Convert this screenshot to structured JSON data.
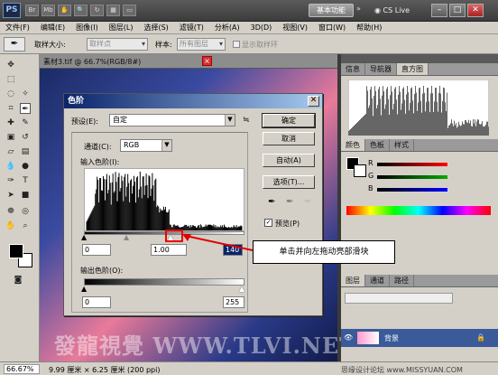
{
  "titlebar": {
    "logo": "PS",
    "workspace": "基本功能",
    "cslive": "CS Live",
    "min": "–",
    "max": "□",
    "close": "✕"
  },
  "menu": [
    "文件(F)",
    "编辑(E)",
    "图像(I)",
    "图层(L)",
    "选择(S)",
    "滤镜(T)",
    "分析(A)",
    "3D(D)",
    "视图(V)",
    "窗口(W)",
    "帮助(H)"
  ],
  "options": {
    "sample_size_label": "取样大小:",
    "sample_size_value": "取样点",
    "sample_label": "样本:",
    "sample_value": "所有图层",
    "show_ring": "显示取样环"
  },
  "document": {
    "tab_label": "素材3.tif @ 66.7%(RGB/8#)",
    "close": "×",
    "watermark": "發龍視覺 WWW.TLVI.NET"
  },
  "status": {
    "zoom": "66.67%",
    "doc_info": "9.99 厘米 × 6.25 厘米 (200 ppi)",
    "credit": "思缘设计论坛 www.MISSYUAN.COM"
  },
  "panels": {
    "top_tabs": [
      "导航器",
      "直方图"
    ],
    "top_tabs_prefix": "导航器",
    "color_tabs": [
      "颜色",
      "色板",
      "样式"
    ],
    "layers_tabs": [
      "图层",
      "通道",
      "路径"
    ],
    "layer_name": "背景"
  },
  "dialog": {
    "title": "色阶",
    "preset_label": "预设(E):",
    "preset_value": "自定",
    "channel_label": "通道(C):",
    "channel_value": "RGB",
    "input_label": "输入色阶(I):",
    "input_black": "0",
    "input_mid": "1.00",
    "input_white": "140",
    "output_label": "输出色阶(O):",
    "output_black": "0",
    "output_white": "255",
    "ok": "确定",
    "cancel": "取消",
    "auto": "自动(A)",
    "options": "选项(T)...",
    "preview": "预览(P)",
    "preset_menu_icon": "≒"
  },
  "callout": "单击并向左拖动亮部滑块",
  "colors": {
    "accent_red": "#e00000",
    "dialog_title_start": "#0a246a",
    "dialog_title_end": "#a6caf0"
  }
}
